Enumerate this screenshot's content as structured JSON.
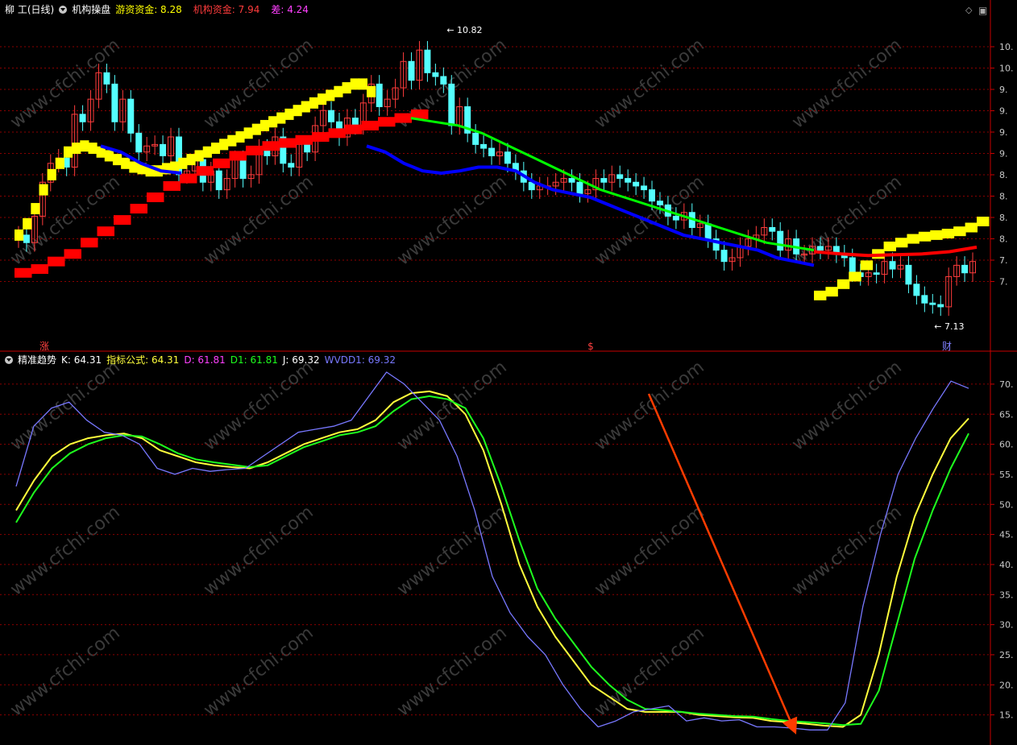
{
  "top_panel": {
    "stock": "柳 工(日线)",
    "indicator": "机构操盘",
    "label_a": "游资资金: 8.28",
    "label_b": "机构资金: 7.94",
    "label_c": "差: 4.24",
    "high_label": "10.82",
    "low_label": "7.13",
    "marker_left": "涨",
    "marker_mid": "$",
    "marker_right": "财",
    "y_ticks": [
      "10.",
      "10.",
      "9.",
      "9.",
      "9.",
      "9.",
      "8.",
      "8.",
      "8.",
      "8.",
      "7.",
      "7."
    ]
  },
  "bottom_panel": {
    "indicator": "精准趋势",
    "label_k": "K: 64.31",
    "label_f": "指标公式: 64.31",
    "label_d": "D: 61.81",
    "label_d1": "D1: 61.81",
    "label_j": "J: 69.32",
    "label_w": "WVDD1: 69.32",
    "y_ticks": [
      "70.",
      "65.",
      "60.",
      "55.",
      "50.",
      "45.",
      "40.",
      "35.",
      "30.",
      "25.",
      "20.",
      "15."
    ]
  },
  "watermark": "www.cfchi.com",
  "colors": {
    "up": "#ff3c3c",
    "down": "#54ffff",
    "yellow": "#ffff00",
    "red": "#ff0000",
    "blue": "#0000ff",
    "green": "#00ff00",
    "k": "#ffff3c",
    "j": "#7878ff",
    "d": "#1eff1e",
    "grid": "#8b0000",
    "axis": "#c80000",
    "arrow": "#ff3c00"
  },
  "chart_data": [
    {
      "type": "candlestick",
      "title": "柳 工(日线)",
      "y_range": [
        7.0,
        11.0
      ],
      "x_count": 120,
      "close": [
        8.1,
        8.0,
        8.35,
        8.8,
        9.05,
        9.12,
        9.0,
        9.7,
        9.6,
        9.9,
        10.25,
        10.1,
        9.6,
        9.9,
        9.45,
        9.2,
        9.28,
        9.3,
        9.15,
        9.4,
        8.9,
        8.95,
        9.1,
        8.8,
        8.95,
        8.7,
        8.85,
        9.1,
        8.85,
        8.9,
        9.25,
        9.15,
        9.4,
        9.05,
        9.0,
        9.3,
        9.2,
        9.55,
        9.75,
        9.6,
        9.4,
        9.65,
        9.55,
        9.85,
        10.1,
        9.8,
        9.9,
        10.05,
        10.4,
        10.15,
        10.55,
        10.25,
        10.2,
        10.1,
        9.55,
        9.8,
        9.45,
        9.3,
        9.25,
        9.15,
        9.2,
        9.05,
        8.95,
        8.8,
        8.7,
        8.75,
        8.75,
        8.8,
        8.85,
        8.8,
        8.65,
        8.7,
        8.85,
        8.8,
        8.9,
        8.85,
        8.8,
        8.75,
        8.7,
        8.55,
        8.5,
        8.35,
        8.3,
        8.4,
        8.2,
        8.25,
        8.05,
        7.9,
        7.75,
        7.8,
        7.95,
        8.05,
        8.1,
        8.2,
        8.15,
        7.9,
        8.05,
        7.85,
        7.85,
        7.95,
        7.9,
        7.95,
        7.85,
        7.8,
        7.6,
        7.55,
        7.6,
        7.58,
        7.75,
        7.65,
        7.7,
        7.45,
        7.3,
        7.2,
        7.18,
        7.15,
        7.55,
        7.7,
        7.6,
        7.75
      ],
      "ma_fast_yellow": [
        8.1,
        8.25,
        8.45,
        8.7,
        8.9,
        9.05,
        9.2,
        9.25,
        9.28,
        9.25,
        9.2,
        9.15,
        9.1,
        9.05,
        9.0,
        8.98,
        8.95,
        8.95,
        8.98,
        9.0,
        9.05,
        9.1,
        9.15,
        9.2,
        9.25,
        9.3,
        9.35,
        9.4,
        9.45,
        9.5,
        9.55,
        9.6,
        9.65,
        9.7,
        9.75,
        9.8,
        9.85,
        9.9,
        9.95,
        10.0,
        10.05,
        10.1,
        10.1,
        10.0
      ],
      "ma_slow_red": [
        7.6,
        7.65,
        7.75,
        7.85,
        8.0,
        8.15,
        8.3,
        8.45,
        8.6,
        8.75,
        8.85,
        8.95,
        9.05,
        9.15,
        9.22,
        9.28,
        9.32,
        9.36,
        9.4,
        9.45,
        9.5,
        9.55,
        9.6,
        9.65,
        9.7
      ],
      "ma_long_green": [
        9.65,
        9.6,
        9.55,
        9.45,
        9.3,
        9.15,
        9.0,
        8.85,
        8.7,
        8.6,
        8.5,
        8.4,
        8.3,
        8.2,
        8.1,
        8.0,
        7.95,
        7.9
      ],
      "ma_blue": [
        9.28,
        9.2,
        9.05,
        8.95,
        8.92,
        8.95,
        9.0,
        9.0,
        8.95,
        8.8,
        8.7,
        8.65,
        8.6,
        8.5,
        8.4,
        8.3,
        8.2,
        8.1,
        8.05,
        8.0,
        7.95,
        7.9,
        7.8,
        7.75,
        7.7
      ],
      "high": 10.82,
      "low": 7.13
    },
    {
      "type": "line",
      "title": "精准趋势",
      "y_range": [
        12.0,
        72.0
      ],
      "series": [
        {
          "name": "K",
          "values": [
            49,
            54,
            58,
            60,
            61,
            61.5,
            61.8,
            61,
            59,
            58,
            57,
            56.5,
            56.2,
            56,
            57,
            58.5,
            60,
            61,
            62,
            62.5,
            64,
            67,
            68.5,
            68.8,
            68,
            65,
            59,
            50,
            40,
            33,
            28,
            24,
            20,
            18,
            16,
            15.5,
            15.5,
            15.5,
            15,
            14.8,
            14.6,
            14.5,
            14,
            13.8,
            13.5,
            13.2,
            13,
            15,
            25,
            38,
            48,
            55,
            61,
            64.3
          ]
        },
        {
          "name": "D",
          "values": [
            47,
            52,
            56,
            58.5,
            60,
            61,
            61.5,
            61.3,
            60,
            58.5,
            57.5,
            57,
            56.6,
            56.2,
            56.5,
            58,
            59.5,
            60.5,
            61.5,
            62,
            63,
            65.5,
            67.5,
            68,
            67.5,
            66,
            61,
            53,
            44,
            36,
            31,
            27,
            23,
            20,
            17.5,
            16,
            15.8,
            15.5,
            15.2,
            15,
            14.8,
            14.7,
            14.3,
            14,
            13.8,
            13.6,
            13.3,
            13.5,
            19,
            30,
            41,
            49,
            56,
            61.8
          ]
        },
        {
          "name": "J",
          "values": [
            53,
            63,
            66,
            67,
            64,
            62,
            61.5,
            60,
            56,
            55,
            56,
            55.5,
            55.8,
            56,
            58,
            60,
            62,
            62.5,
            63,
            64,
            68,
            72,
            70,
            67,
            64,
            58,
            49,
            38,
            32,
            28,
            25,
            20,
            16,
            13,
            14,
            15.5,
            16,
            16.5,
            14,
            14.5,
            14,
            14.2,
            13,
            13,
            12.8,
            12.5,
            12.5,
            17,
            33,
            45,
            55,
            61,
            66,
            70.5,
            69.3
          ]
        }
      ]
    }
  ]
}
